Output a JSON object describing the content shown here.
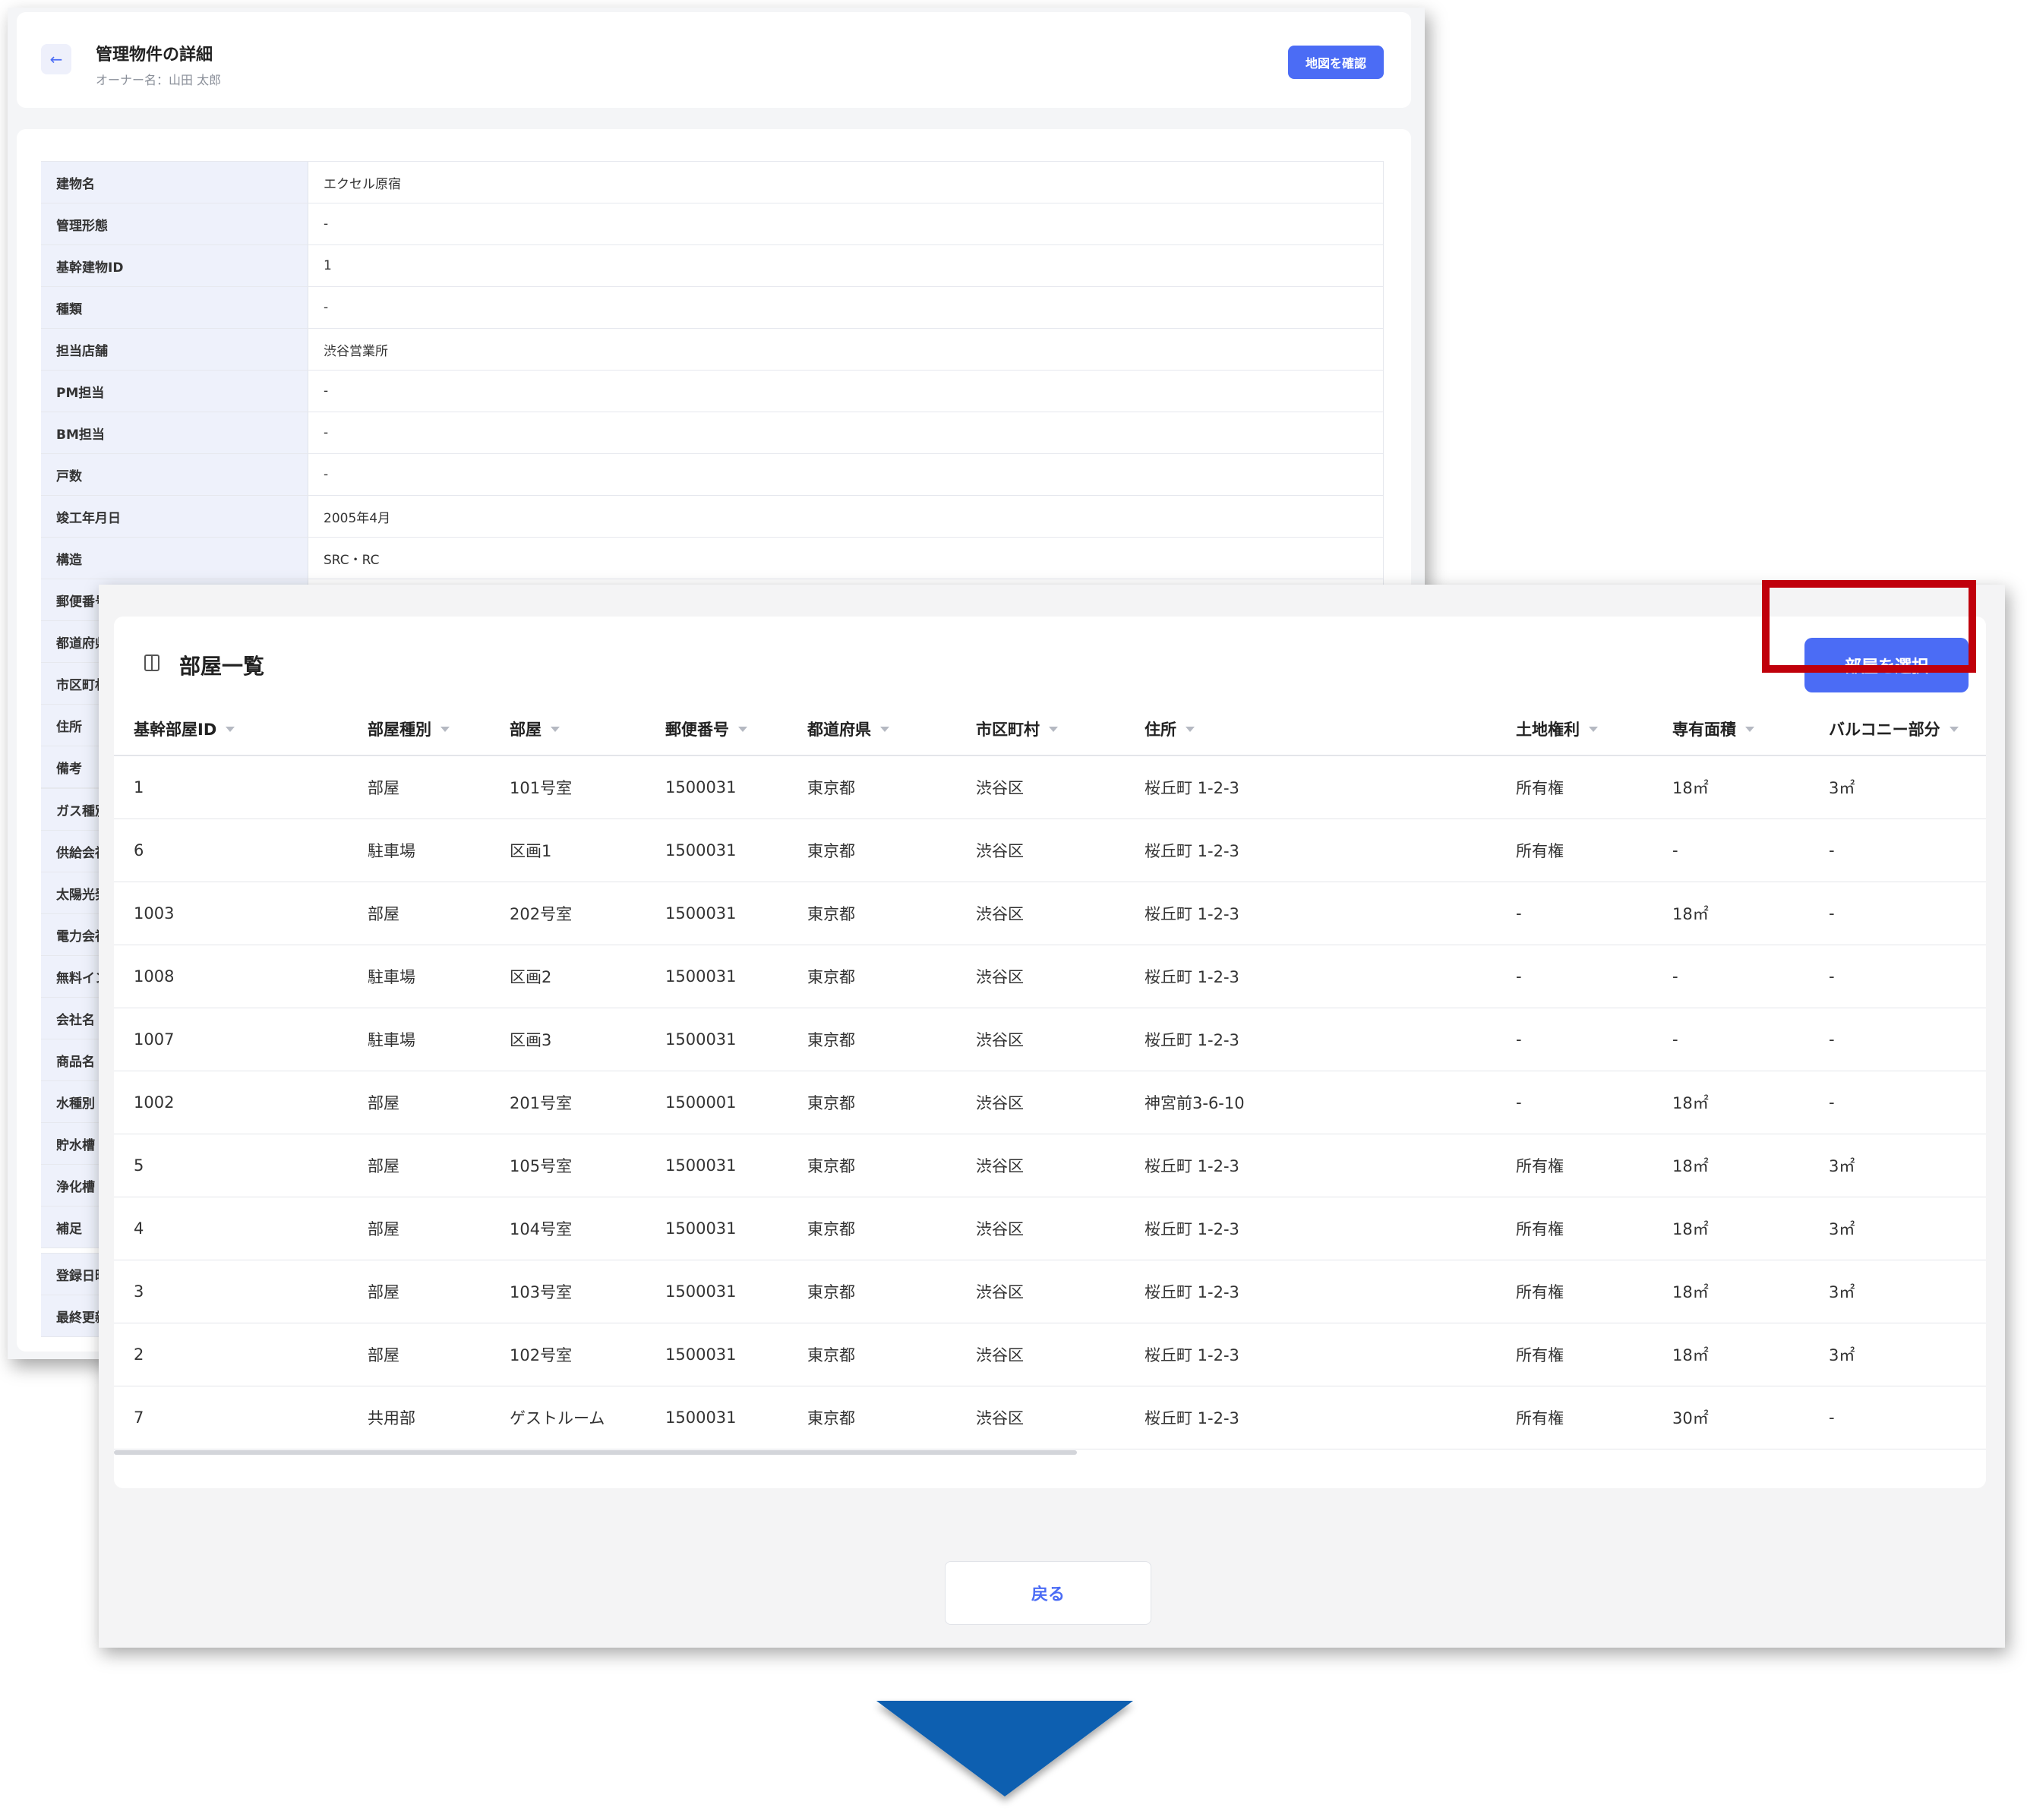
{
  "detail": {
    "back_icon": "←",
    "title": "管理物件の詳細",
    "owner": "オーナー名：山田 太郎",
    "map_button": "地図を確認",
    "section1": [
      {
        "label": "建物名",
        "value": "エクセル原宿"
      },
      {
        "label": "管理形態",
        "value": "-"
      },
      {
        "label": "基幹建物ID",
        "value": "1"
      },
      {
        "label": "種類",
        "value": "-"
      },
      {
        "label": "担当店舗",
        "value": "渋谷営業所"
      },
      {
        "label": "PM担当",
        "value": "-"
      },
      {
        "label": "BM担当",
        "value": "-"
      },
      {
        "label": "戸数",
        "value": "-"
      },
      {
        "label": "竣工年月日",
        "value": "2005年4月"
      },
      {
        "label": "構造",
        "value": "SRC・RC"
      },
      {
        "label": "郵便番号",
        "value": ""
      },
      {
        "label": "都道府県",
        "value": ""
      },
      {
        "label": "市区町村",
        "value": ""
      },
      {
        "label": "住所",
        "value": ""
      },
      {
        "label": "備考",
        "value": ""
      }
    ],
    "section2": [
      {
        "label": "ガス種別",
        "value": ""
      },
      {
        "label": "供給会社",
        "value": ""
      },
      {
        "label": "太陽光発",
        "value": ""
      },
      {
        "label": "電力会社",
        "value": ""
      },
      {
        "label": "無料イン",
        "value": ""
      },
      {
        "label": "会社名",
        "value": ""
      },
      {
        "label": "商品名",
        "value": ""
      },
      {
        "label": "水種別",
        "value": ""
      },
      {
        "label": "貯水槽",
        "value": ""
      },
      {
        "label": "浄化槽",
        "value": ""
      },
      {
        "label": "補足",
        "value": ""
      }
    ],
    "section3": [
      {
        "label": "登録日時",
        "value": ""
      },
      {
        "label": "最終更新",
        "value": ""
      }
    ]
  },
  "rooms": {
    "title": "部屋一覧",
    "icon": "door-icon",
    "select_button": "部屋を選択",
    "columns": [
      "基幹部屋ID",
      "部屋種別",
      "部屋",
      "郵便番号",
      "都道府県",
      "市区町村",
      "住所",
      "土地権利",
      "専有面積",
      "バルコニー部分"
    ],
    "rows": [
      [
        "1",
        "部屋",
        "101号室",
        "1500031",
        "東京都",
        "渋谷区",
        "桜丘町 1-2-3",
        "所有権",
        "18㎡",
        "3㎡"
      ],
      [
        "6",
        "駐車場",
        "区画1",
        "1500031",
        "東京都",
        "渋谷区",
        "桜丘町 1-2-3",
        "所有権",
        "-",
        "-"
      ],
      [
        "1003",
        "部屋",
        "202号室",
        "1500031",
        "東京都",
        "渋谷区",
        "桜丘町 1-2-3",
        "-",
        "18㎡",
        "-"
      ],
      [
        "1008",
        "駐車場",
        "区画2",
        "1500031",
        "東京都",
        "渋谷区",
        "桜丘町 1-2-3",
        "-",
        "-",
        "-"
      ],
      [
        "1007",
        "駐車場",
        "区画3",
        "1500031",
        "東京都",
        "渋谷区",
        "桜丘町 1-2-3",
        "-",
        "-",
        "-"
      ],
      [
        "1002",
        "部屋",
        "201号室",
        "1500001",
        "東京都",
        "渋谷区",
        "神宮前3-6-10",
        "-",
        "18㎡",
        "-"
      ],
      [
        "5",
        "部屋",
        "105号室",
        "1500031",
        "東京都",
        "渋谷区",
        "桜丘町 1-2-3",
        "所有権",
        "18㎡",
        "3㎡"
      ],
      [
        "4",
        "部屋",
        "104号室",
        "1500031",
        "東京都",
        "渋谷区",
        "桜丘町 1-2-3",
        "所有権",
        "18㎡",
        "3㎡"
      ],
      [
        "3",
        "部屋",
        "103号室",
        "1500031",
        "東京都",
        "渋谷区",
        "桜丘町 1-2-3",
        "所有権",
        "18㎡",
        "3㎡"
      ],
      [
        "2",
        "部屋",
        "102号室",
        "1500031",
        "東京都",
        "渋谷区",
        "桜丘町 1-2-3",
        "所有権",
        "18㎡",
        "3㎡"
      ],
      [
        "7",
        "共用部",
        "ゲストルーム",
        "1500031",
        "東京都",
        "渋谷区",
        "桜丘町 1-2-3",
        "所有権",
        "30㎡",
        "-"
      ]
    ],
    "return_button": "戻る"
  },
  "colors": {
    "accent": "#4b6cf5",
    "highlight": "#c0000b",
    "arrow": "#0a5eb0",
    "label_bg": "#eef1fb"
  }
}
